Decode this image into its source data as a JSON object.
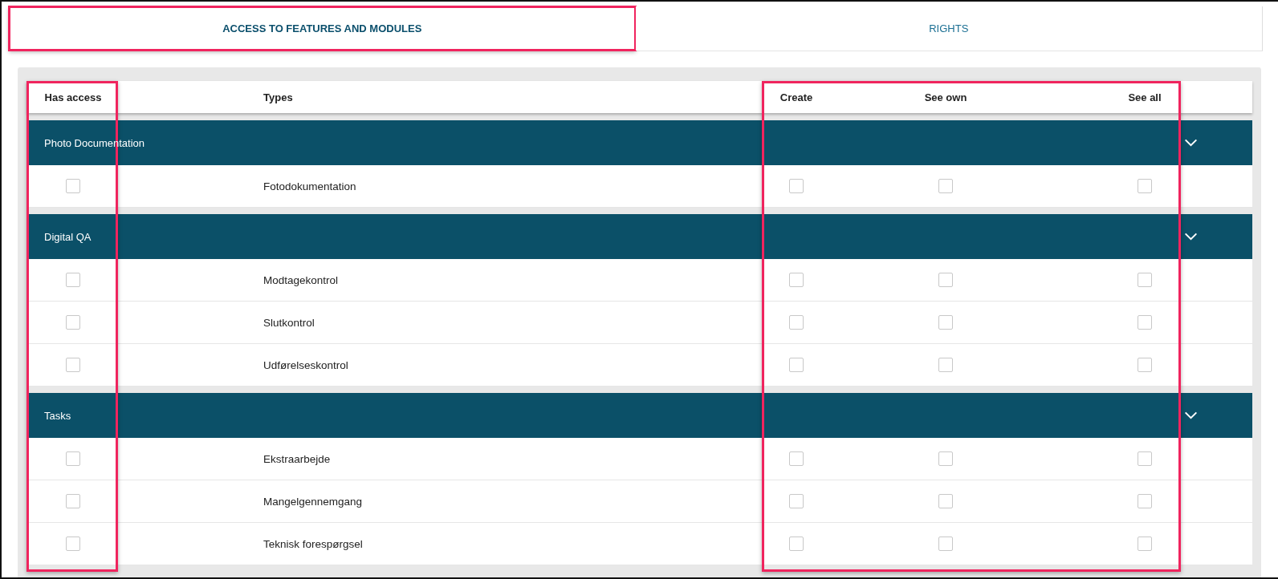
{
  "tabs": [
    {
      "label": "ACCESS TO FEATURES AND MODULES",
      "selected": true,
      "highlighted": true
    },
    {
      "label": "RIGHTS",
      "selected": false,
      "highlighted": false
    }
  ],
  "table": {
    "columns": [
      {
        "label": "Has access",
        "highlighted": true
      },
      {
        "label": "Types",
        "highlighted": false
      },
      {
        "label": "Create",
        "highlighted": true
      },
      {
        "label": "See own",
        "highlighted": true
      },
      {
        "label": "See all",
        "highlighted": true
      }
    ],
    "groups": [
      {
        "name": "Photo Documentation",
        "expanded": true,
        "rows": [
          {
            "type": "Fotodokumentation",
            "has_access": false,
            "create": false,
            "see_own": false,
            "see_all": false
          }
        ]
      },
      {
        "name": "Digital QA",
        "expanded": true,
        "rows": [
          {
            "type": "Modtagekontrol",
            "has_access": false,
            "create": false,
            "see_own": false,
            "see_all": false
          },
          {
            "type": "Slutkontrol",
            "has_access": false,
            "create": false,
            "see_own": false,
            "see_all": false
          },
          {
            "type": "Udførelseskontrol",
            "has_access": false,
            "create": false,
            "see_own": false,
            "see_all": false
          }
        ]
      },
      {
        "name": "Tasks",
        "expanded": true,
        "rows": [
          {
            "type": "Ekstraarbejde",
            "has_access": false,
            "create": false,
            "see_own": false,
            "see_all": false
          },
          {
            "type": "Mangelgennemgang",
            "has_access": false,
            "create": false,
            "see_own": false,
            "see_all": false
          },
          {
            "type": "Teknisk forespørgsel",
            "has_access": false,
            "create": false,
            "see_own": false,
            "see_all": false
          }
        ]
      }
    ]
  }
}
